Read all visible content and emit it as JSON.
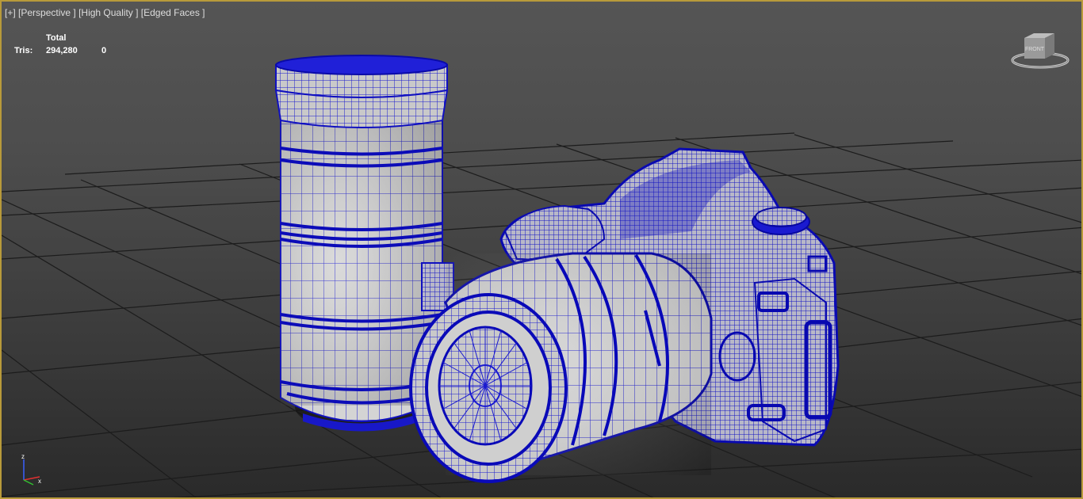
{
  "viewport": {
    "label_plus": "[+]",
    "label_view": "[Perspective ]",
    "label_shading": "[High Quality ]",
    "label_faces": "[Edged Faces ]"
  },
  "stats": {
    "header": "Total",
    "label": "Tris:",
    "total": "294,280",
    "selected": "0"
  },
  "viewcube": {
    "icon": "viewcube-icon",
    "face_label": "FRONT"
  },
  "axis": {
    "icon": "axis-tripod-icon",
    "z": "z",
    "x": "x"
  },
  "colors": {
    "border": "#b89a3a",
    "wire": "#1010c8",
    "grid": "#1a1a1a",
    "surface": "#cfcfcf"
  }
}
